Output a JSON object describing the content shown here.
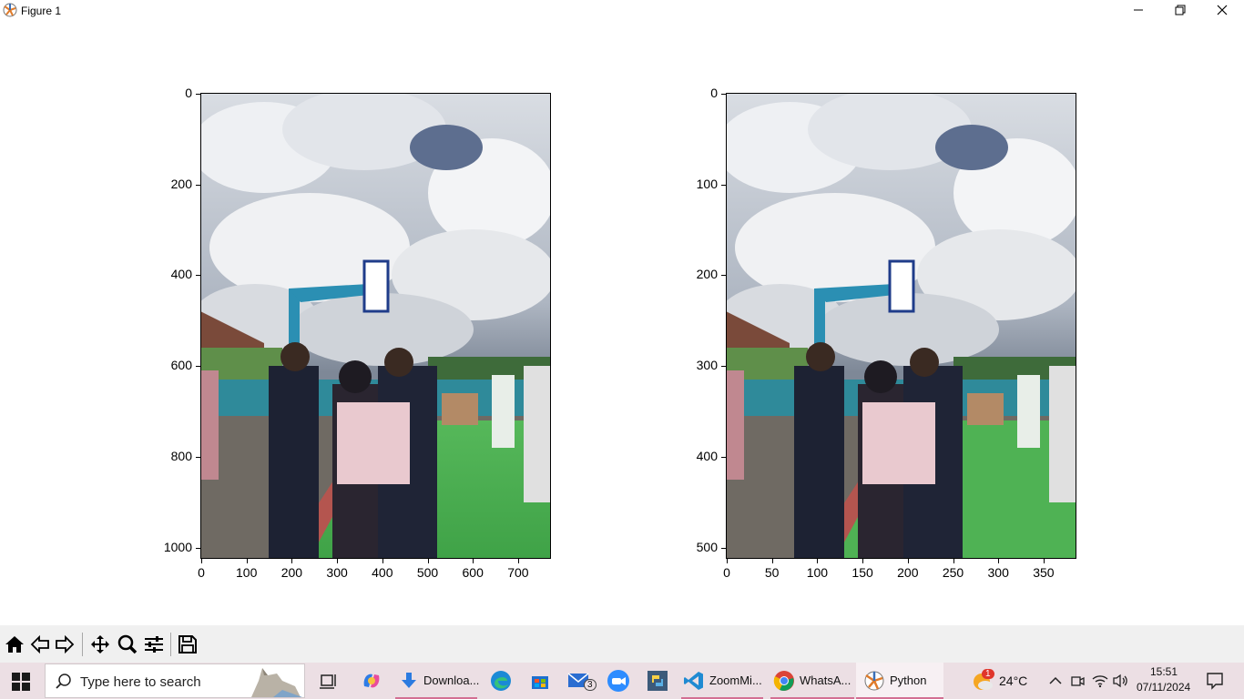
{
  "window": {
    "title": "Figure 1"
  },
  "figure": {
    "left_axes": {
      "yticks": [
        "0",
        "200",
        "400",
        "600",
        "800",
        "1000"
      ],
      "xticks": [
        "0",
        "100",
        "200",
        "300",
        "400",
        "500",
        "600",
        "700"
      ]
    },
    "right_axes": {
      "yticks": [
        "0",
        "100",
        "200",
        "300",
        "400",
        "500"
      ],
      "xticks": [
        "0",
        "50",
        "100",
        "150",
        "200",
        "250",
        "300",
        "350"
      ]
    }
  },
  "toolbar": {
    "buttons": [
      "home-icon",
      "back-icon",
      "forward-icon",
      "pan-icon",
      "zoom-icon",
      "configure-subplots-icon",
      "save-icon"
    ]
  },
  "taskbar": {
    "search_placeholder": "Type here to search",
    "apps": {
      "downloads": "Downloa...",
      "zoom_mi": "ZoomMi...",
      "whatsapp": "WhatsA...",
      "python": "Python"
    },
    "mail_badge": "3",
    "weather_badge": "1",
    "temperature": "24°C",
    "time": "15:51",
    "date": "07/11/2024"
  },
  "colors": {
    "taskbar_bg": "#ecdfe4",
    "toolbar_bg": "#f0f0f0",
    "accent_underline": "#d36f93"
  }
}
